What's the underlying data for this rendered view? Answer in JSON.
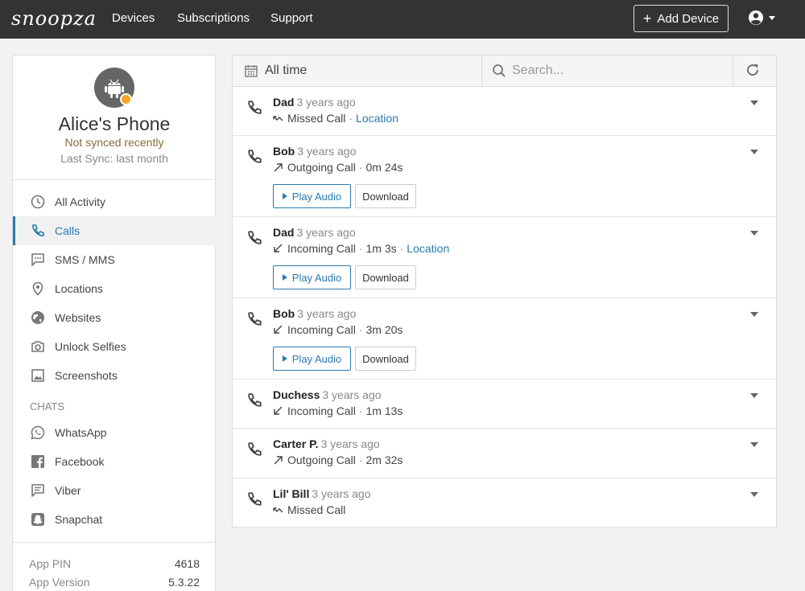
{
  "brand": {
    "logo_text": "snoopza"
  },
  "nav": {
    "links": [
      "Devices",
      "Subscriptions",
      "Support"
    ],
    "add_device_label": "Add Device",
    "user_icon": "user-circle-icon"
  },
  "device": {
    "name": "Alice's Phone",
    "status": "Not synced recently",
    "last_sync": "Last Sync: last month",
    "avatar_icon": "android-icon",
    "status_color": "#f5a623"
  },
  "menu": {
    "items": [
      {
        "label": "All Activity",
        "icon": "clock-icon"
      },
      {
        "label": "Calls",
        "icon": "phone-icon",
        "active": true
      },
      {
        "label": "SMS / MMS",
        "icon": "message-icon"
      },
      {
        "label": "Locations",
        "icon": "location-pin-icon"
      },
      {
        "label": "Websites",
        "icon": "globe-icon"
      },
      {
        "label": "Unlock Selfies",
        "icon": "camera-icon"
      },
      {
        "label": "Screenshots",
        "icon": "image-icon"
      }
    ],
    "chats_header": "CHATS",
    "chats": [
      {
        "label": "WhatsApp",
        "icon": "whatsapp-icon"
      },
      {
        "label": "Facebook",
        "icon": "facebook-icon"
      },
      {
        "label": "Viber",
        "icon": "viber-icon"
      },
      {
        "label": "Snapchat",
        "icon": "snapchat-icon"
      }
    ]
  },
  "meta": {
    "pin_label": "App PIN",
    "pin_value": "4618",
    "version_label": "App Version",
    "version_value": "5.3.22"
  },
  "toolbar": {
    "range_label": "All time",
    "search_placeholder": "Search..."
  },
  "calls": [
    {
      "contact": "Dad",
      "ago": "3 years ago",
      "direction": "missed",
      "type": "Missed Call",
      "duration": "",
      "location": "Location",
      "has_audio": false
    },
    {
      "contact": "Bob",
      "ago": "3 years ago",
      "direction": "outgoing",
      "type": "Outgoing Call",
      "duration": "0m 24s",
      "location": "",
      "has_audio": true
    },
    {
      "contact": "Dad",
      "ago": "3 years ago",
      "direction": "incoming",
      "type": "Incoming Call",
      "duration": "1m 3s",
      "location": "Location",
      "has_audio": true
    },
    {
      "contact": "Bob",
      "ago": "3 years ago",
      "direction": "incoming",
      "type": "Incoming Call",
      "duration": "3m 20s",
      "location": "",
      "has_audio": true
    },
    {
      "contact": "Duchess",
      "ago": "3 years ago",
      "direction": "incoming",
      "type": "Incoming Call",
      "duration": "1m 13s",
      "location": "",
      "has_audio": false
    },
    {
      "contact": "Carter P.",
      "ago": "3 years ago",
      "direction": "outgoing",
      "type": "Outgoing Call",
      "duration": "2m 32s",
      "location": "",
      "has_audio": false
    },
    {
      "contact": "Lil' Bill",
      "ago": "3 years ago",
      "direction": "missed",
      "type": "Missed Call",
      "duration": "",
      "location": "",
      "has_audio": false
    }
  ],
  "audio_buttons": {
    "play_label": "Play Audio",
    "download_label": "Download"
  },
  "colors": {
    "topbar": "#333333",
    "accent": "#2a7ab0",
    "warning_text": "#8a6d3b"
  }
}
